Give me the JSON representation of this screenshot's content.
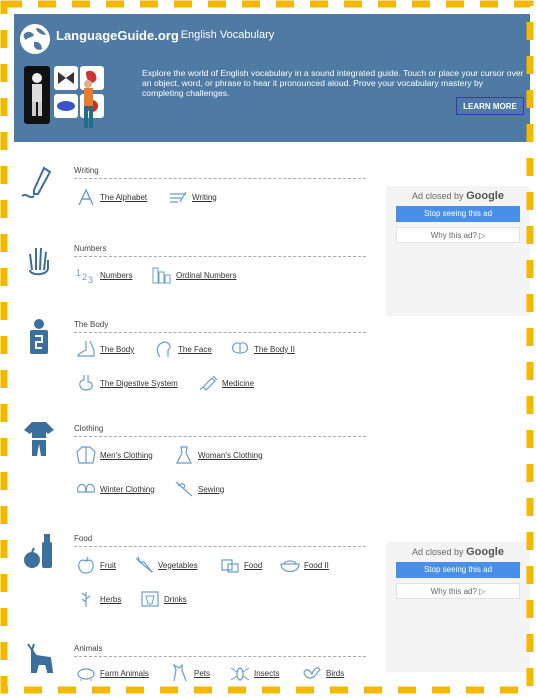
{
  "header": {
    "site_name": "LanguageGuide.org",
    "site_sub": "· English Vocabulary",
    "description": "Explore the world of English vocabulary in a sound integrated guide. Touch or place your cursor over an object, word, or phrase to hear it pronounced aloud. Prove your vocabulary mastery by completing challenges.",
    "learn_more": "LEARN MORE",
    "accent": "#4e7aa3",
    "frame_color": "#f5b800"
  },
  "sections": [
    {
      "title": "Writing",
      "items": [
        {
          "label": "The Alphabet",
          "icon": "letter-a-icon"
        },
        {
          "label": "Writing",
          "icon": "pencil-icon"
        }
      ]
    },
    {
      "title": "Numbers",
      "items": [
        {
          "label": "Numbers",
          "icon": "numbers-icon"
        },
        {
          "label": "Ordinal Numbers",
          "icon": "ordinal-icon"
        }
      ]
    },
    {
      "title": "The Body",
      "items": [
        {
          "label": "The Body",
          "icon": "foot-icon"
        },
        {
          "label": "The Face",
          "icon": "face-icon"
        },
        {
          "label": "The Body II",
          "icon": "brain-icon"
        },
        {
          "label": "The Digestive System",
          "icon": "stomach-icon"
        },
        {
          "label": "Medicine",
          "icon": "syringe-icon"
        }
      ]
    },
    {
      "title": "Clothing",
      "items": [
        {
          "label": "Men's Clothing",
          "icon": "jacket-icon"
        },
        {
          "label": "Woman's Clothing",
          "icon": "dress-icon"
        },
        {
          "label": "Winter Clothing",
          "icon": "mittens-icon"
        },
        {
          "label": "Sewing",
          "icon": "needle-icon"
        }
      ]
    },
    {
      "title": "Food",
      "items": [
        {
          "label": "Fruit",
          "icon": "apple-icon"
        },
        {
          "label": "Vegetables",
          "icon": "carrot-icon"
        },
        {
          "label": "Food",
          "icon": "cheese-icon"
        },
        {
          "label": "Food II",
          "icon": "bowl-icon"
        },
        {
          "label": "Herbs",
          "icon": "herb-icon"
        },
        {
          "label": "Drinks",
          "icon": "drink-icon"
        }
      ]
    },
    {
      "title": "Animals",
      "items": [
        {
          "label": "Farm Animals",
          "icon": "pig-icon"
        },
        {
          "label": "Pets",
          "icon": "cat-icon"
        },
        {
          "label": "Insects",
          "icon": "insect-icon"
        },
        {
          "label": "Birds",
          "icon": "bird-icon"
        }
      ]
    }
  ],
  "ads": [
    {
      "closed_by": "Ad closed by",
      "brand": "Google",
      "stop": "Stop seeing this ad",
      "why": "Why this ad? ▷"
    },
    {
      "closed_by": "Ad closed by",
      "brand": "Google",
      "stop": "Stop seeing this ad",
      "why": "Why this ad? ▷"
    }
  ]
}
